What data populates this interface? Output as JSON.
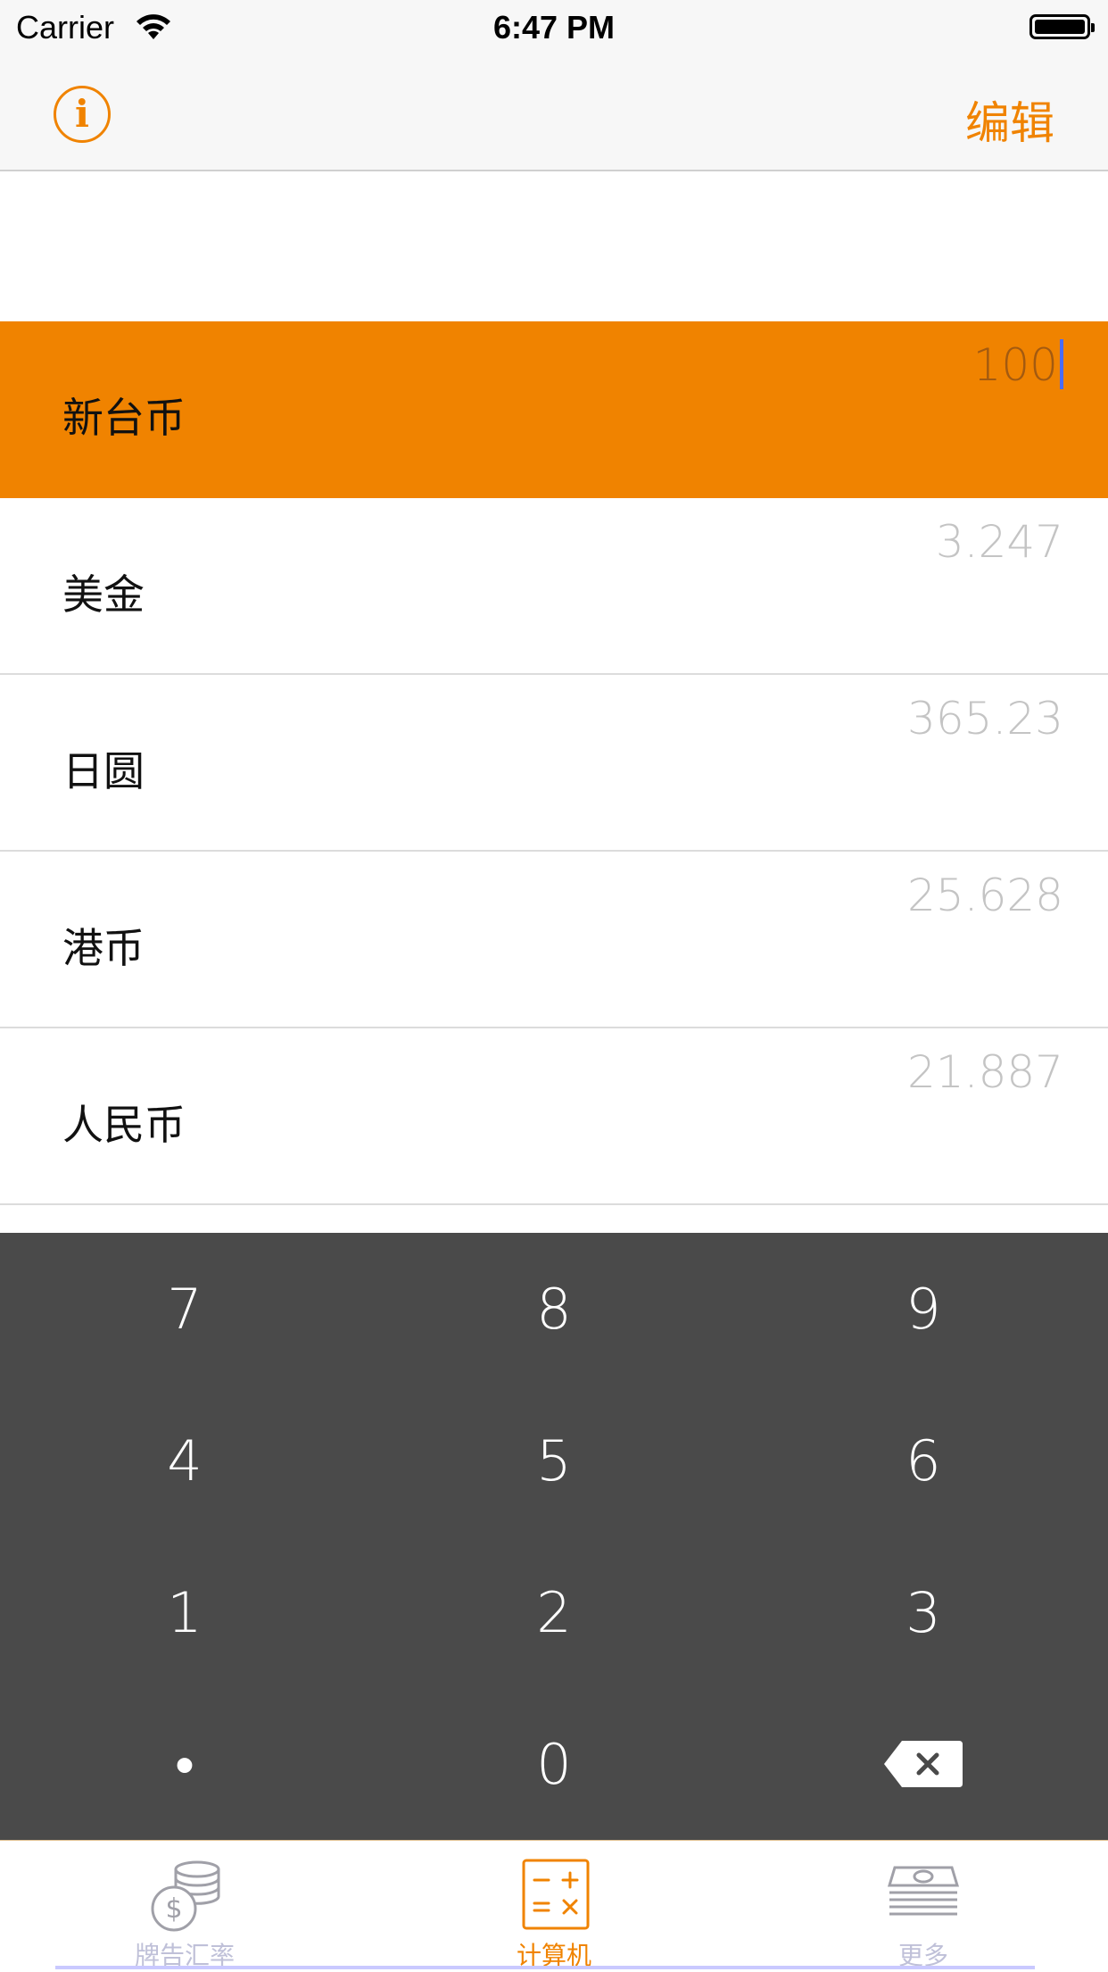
{
  "status_bar": {
    "carrier": "Carrier",
    "time": "6:47 PM"
  },
  "nav": {
    "edit_label": "编辑",
    "info_icon_glyph": "i"
  },
  "currencies": [
    {
      "name": "新台币",
      "value": "100",
      "selected": true
    },
    {
      "name": "美金",
      "value": "3.247",
      "selected": false
    },
    {
      "name": "日圆",
      "value": "365.23",
      "selected": false
    },
    {
      "name": "港币",
      "value": "25.628",
      "selected": false
    },
    {
      "name": "人民币",
      "value": "21.887",
      "selected": false
    }
  ],
  "keypad": {
    "keys": [
      "7",
      "8",
      "9",
      "4",
      "5",
      "6",
      "1",
      "2",
      "3",
      "•",
      "0"
    ],
    "backspace_icon": "backspace-icon"
  },
  "tabs": [
    {
      "label": "牌告汇率",
      "icon": "coins-dollar-icon",
      "active": false
    },
    {
      "label": "计算机",
      "icon": "calculator-icon",
      "active": true
    },
    {
      "label": "更多",
      "icon": "banknotes-icon",
      "active": false
    }
  ],
  "colors": {
    "accent": "#f08300",
    "keypad_bg": "#4a4a4a",
    "inactive_tab": "#bfc0d8",
    "value_text": "#c4c4c4"
  }
}
